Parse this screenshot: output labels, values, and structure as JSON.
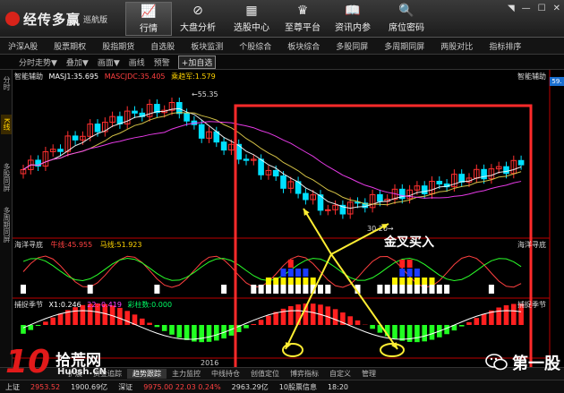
{
  "app": {
    "logo_text": "经传多赢",
    "edition": "巡航版"
  },
  "nav": [
    {
      "label": "行情",
      "icon": "chart-line-icon",
      "glyph": "📈"
    },
    {
      "label": "大盘分析",
      "icon": "compass-icon",
      "glyph": "⊘"
    },
    {
      "label": "选股中心",
      "icon": "grid-icon",
      "glyph": "▦"
    },
    {
      "label": "至尊平台",
      "icon": "crown-icon",
      "glyph": "♛"
    },
    {
      "label": "资讯内参",
      "icon": "book-icon",
      "glyph": "📖"
    },
    {
      "label": "席位密码",
      "icon": "magnifier-icon",
      "glyph": "🔍"
    }
  ],
  "window_controls": [
    "◥",
    "—",
    "☐",
    "✕"
  ],
  "menu": [
    "沪深A股",
    "股票期权",
    "股指期货",
    "自选股",
    "板块监测",
    "个股综合",
    "板块综合",
    "多股同屏",
    "多周期同屏",
    "两股对比",
    "指标排序"
  ],
  "subbar": [
    "分时走势▼",
    "叠加▼",
    "画面▼",
    "画线",
    "预警"
  ],
  "subbar_add": "+加自选",
  "side_tabs": [
    "分时",
    "K线",
    "多股同屏",
    "多周期同屏"
  ],
  "colors": {
    "up": "#ff3030",
    "down": "#00e0ff",
    "ma5": "#ffffff",
    "ma10": "#e8d44d",
    "ma20": "#ff40ff",
    "accent_box": "#ff2a2a",
    "arrow": "#ffee33"
  },
  "panels": {
    "main": {
      "title": "智能辅助",
      "ind1": "MASJ1:35.695",
      "ind2": "MASCJDC:35.405",
      "ind3": "乘趋军:1.579",
      "title_right": "智能辅助",
      "high_label": "55.35",
      "low_label": "30.20",
      "annotation": "金叉买入"
    },
    "sub1": {
      "title": "海洋寻底",
      "v1": "牛线:45.955",
      "v2": "马线:51.923",
      "title_right": "海洋寻底"
    },
    "sub2": {
      "title": "捕捉季节",
      "v1": "X1:0.246",
      "v2": "22:-0.419",
      "v3": "彩柱数:0.000",
      "title_right": "捕捉季节"
    }
  },
  "year_label": "2016",
  "price_tag": "59.",
  "bottom_tabs": [
    "扩展",
    "资金追踪",
    "趋势跟踪",
    "主力监控",
    "中线持仓",
    "创值定位",
    "博弈指标",
    "自定义",
    "管理"
  ],
  "status": [
    {
      "text": "上证",
      "color": "#ddd"
    },
    {
      "text": "2953.52",
      "color": "#ff4040"
    },
    {
      "text": "1900.69亿",
      "color": "#ddd"
    },
    {
      "text": "深证",
      "color": "#ddd"
    },
    {
      "text": "9975.00 22.03 0.24%",
      "color": "#ff4040"
    },
    {
      "text": "2963.29亿",
      "color": "#ddd"
    },
    {
      "text": "10股票信息",
      "color": "#ddd"
    },
    {
      "text": "18:20",
      "color": "#ddd"
    }
  ],
  "watermark_left": {
    "num": "10",
    "name": "拾荒网",
    "domain": "Hu0sh.CN"
  },
  "watermark_right": "第一股"
}
